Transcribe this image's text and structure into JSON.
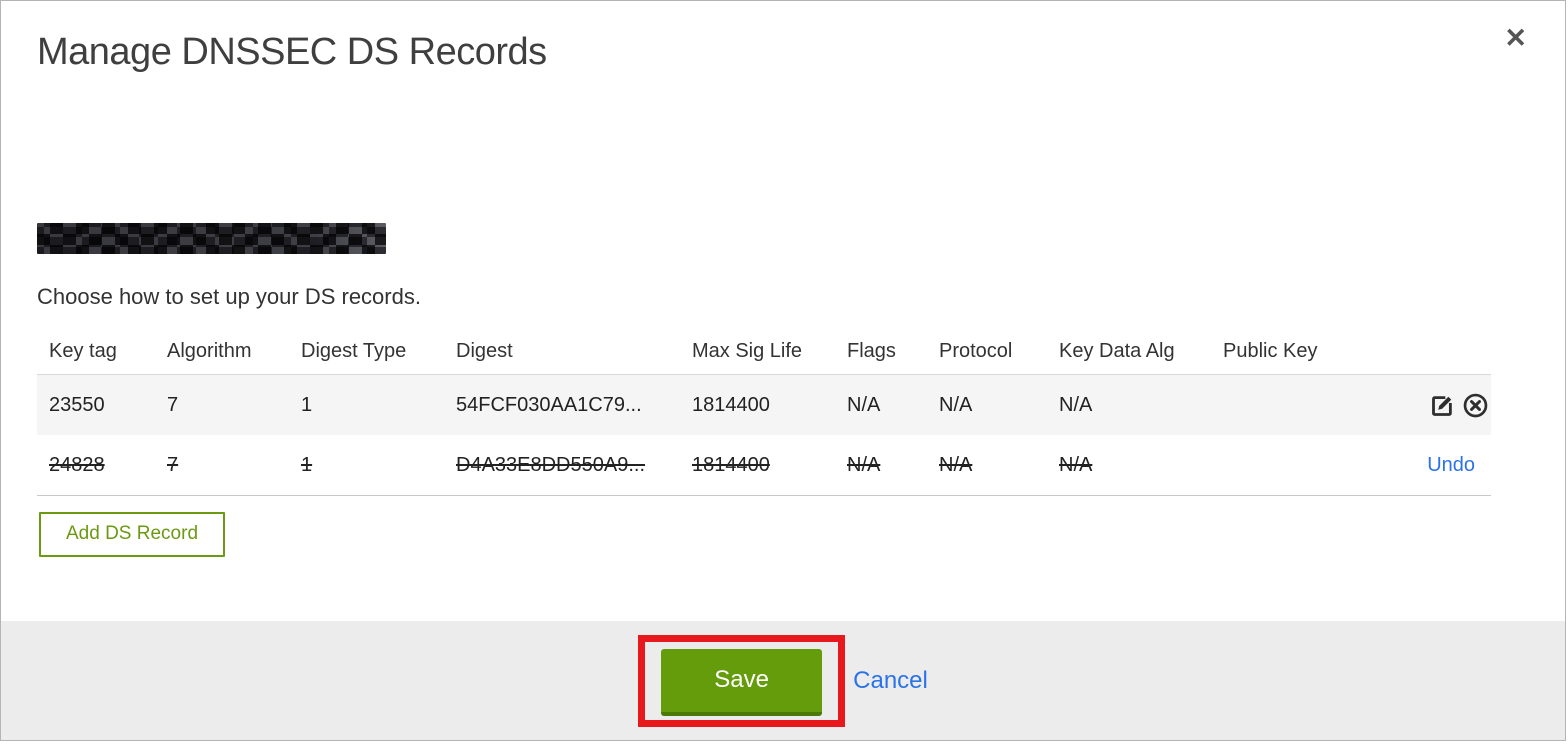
{
  "modal": {
    "title": "Manage DNSSEC DS Records",
    "close_glyph": "✕",
    "domain_redacted": true,
    "subtitle": "Choose how to set up your DS records."
  },
  "table": {
    "headers": [
      "Key tag",
      "Algorithm",
      "Digest Type",
      "Digest",
      "Max Sig Life",
      "Flags",
      "Protocol",
      "Key Data Alg",
      "Public Key"
    ],
    "rows": [
      {
        "state": "normal",
        "cells": [
          "23550",
          "7",
          "1",
          "54FCF030AA1C79...",
          "1814400",
          "N/A",
          "N/A",
          "N/A",
          ""
        ],
        "actions": [
          "edit-icon",
          "delete-circle-icon"
        ]
      },
      {
        "state": "deleted",
        "cells": [
          "24828",
          "7",
          "1",
          "D4A33E8DD550A9...",
          "1814400",
          "N/A",
          "N/A",
          "N/A",
          ""
        ],
        "undo_label": "Undo"
      }
    ]
  },
  "buttons": {
    "add_ds_record": "Add DS Record",
    "save": "Save",
    "cancel": "Cancel"
  },
  "colors": {
    "accent_green": "#649c0b",
    "accent_green_dark": "#4c7a07",
    "outline_green": "#6b9a11",
    "link_blue": "#2b73e8",
    "annotation_red": "#e8191d",
    "footer_bg": "#ececec",
    "row_alt_bg": "#f5f5f5",
    "title_gray": "#3f3f3f"
  }
}
